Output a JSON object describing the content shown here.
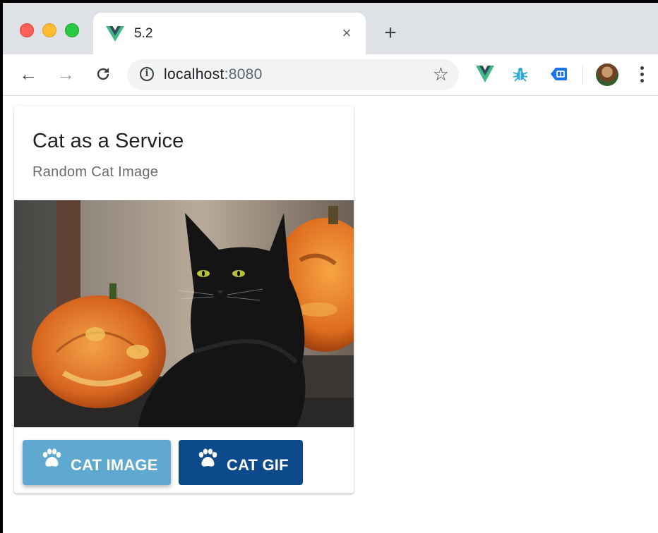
{
  "browser": {
    "tab": {
      "title": "5.2",
      "close_label": "×"
    },
    "new_tab_label": "+",
    "nav": {
      "back": "←",
      "forward": "→",
      "reload": "C"
    },
    "address": {
      "host": "localhost",
      "port": ":8080",
      "info_glyph": "i"
    },
    "bookmark_glyph": "☆",
    "extensions": [
      "vue-devtools-icon",
      "bug-icon",
      "tag-icon"
    ],
    "colors": {
      "tabstrip": "#dee1e6",
      "vue_green": "#41b883",
      "vue_dark": "#35495e"
    }
  },
  "card": {
    "title": "Cat as a Service",
    "subtitle": "Random Cat Image",
    "image_alt": "black cat with jack-o'-lanterns",
    "buttons": [
      {
        "label": "CAT IMAGE",
        "icon": "paw-icon",
        "color": "#5fa8cf"
      },
      {
        "label": "CAT GIF",
        "icon": "paw-icon",
        "color": "#0d4a8b"
      }
    ]
  }
}
